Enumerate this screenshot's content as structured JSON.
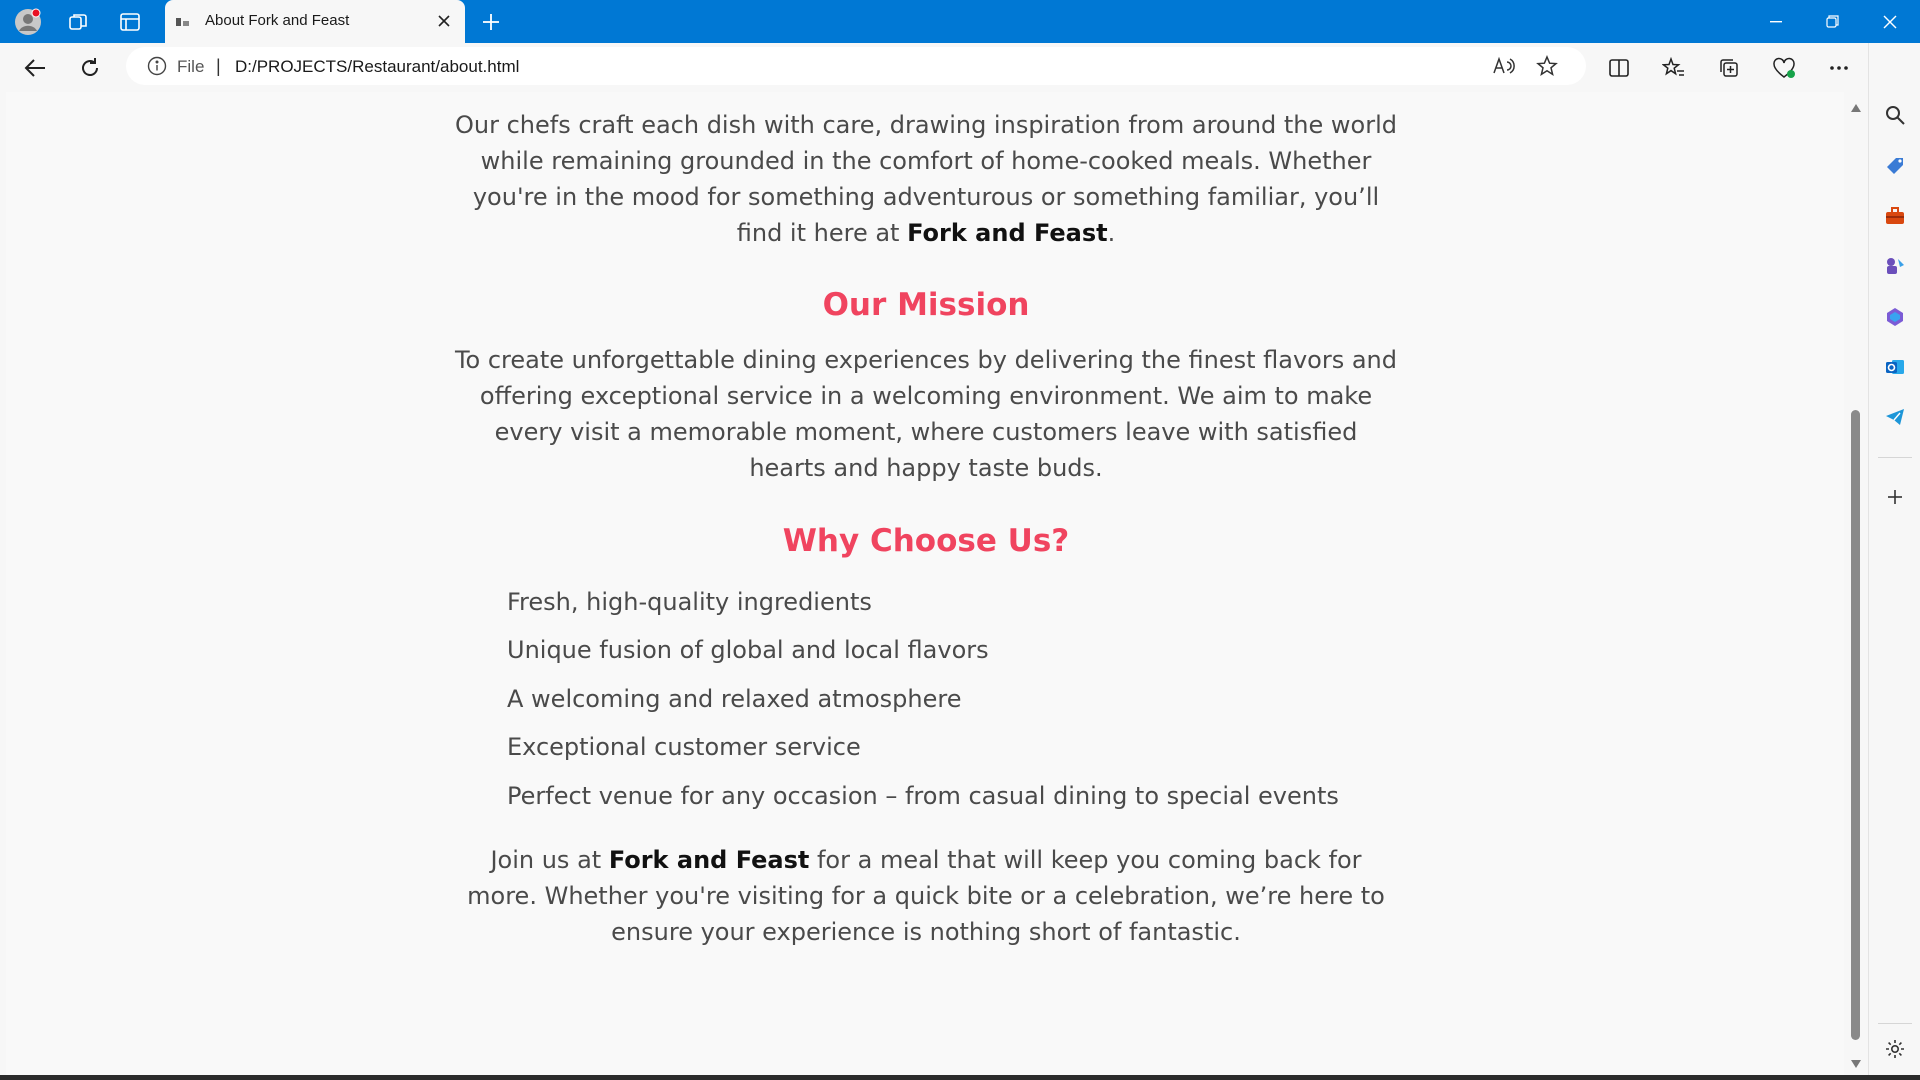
{
  "browser": {
    "tab": {
      "title": "About Fork and Feast"
    },
    "address": {
      "scheme_label": "File",
      "separator": "|",
      "url": "D:/PROJECTS/Restaurant/about.html"
    },
    "accent_color": "#0078d4"
  },
  "page": {
    "intro": {
      "text": "Our chefs craft each dish with care, drawing inspiration from around the world while remaining grounded in the comfort of home-cooked meals. Whether you're in the mood for something adventurous or something familiar, you’ll find it here at ",
      "brand": "Fork and Feast",
      "end": "."
    },
    "mission": {
      "heading": "Our Mission",
      "text": "To create unforgettable dining experiences by delivering the finest flavors and offering exceptional service in a welcoming environment. We aim to make every visit a memorable moment, where customers leave with satisfied hearts and happy taste buds."
    },
    "why": {
      "heading": "Why Choose Us?",
      "items": [
        "Fresh, high-quality ingredients",
        "Unique fusion of global and local flavors",
        "A welcoming and relaxed atmosphere",
        "Exceptional customer service",
        "Perfect venue for any occasion – from casual dining to special events"
      ]
    },
    "closing": {
      "lead": "Join us at ",
      "brand": "Fork and Feast",
      "text": " for a meal that will keep you coming back for more. Whether you're visiting for a quick bite or a celebration, we’re here to ensure your experience is nothing short of fantastic."
    },
    "heading_color": "#f0445f"
  }
}
